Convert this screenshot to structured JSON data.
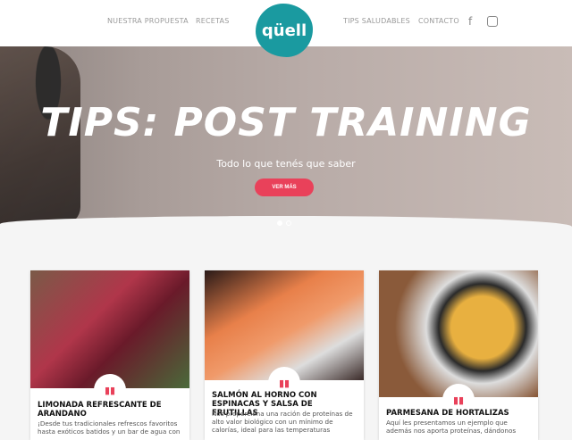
{
  "nav": {
    "items": [
      "NUESTRA PROPUESTA",
      "RECETAS",
      "TIPS SALUDABLES",
      "CONTACTO"
    ],
    "logo": "qüell",
    "social": [
      "facebook-icon",
      "instagram-icon"
    ]
  },
  "hero": {
    "title": "TIPS: POST TRAINING",
    "subtitle": "Todo lo que tenés que saber",
    "button": "VER MÁS",
    "slides": 2,
    "active_slide": 1
  },
  "cards": [
    {
      "title": "LIMONADA REFRESCANTE DE ARANDANO",
      "text": "¡Desde tus tradicionales refrescos favoritos hasta exóticos batidos y un bar de agua con",
      "icon": "book-icon"
    },
    {
      "title": "SALMÓN AL HORNO CON ESPINACAS Y SALSA DE FRUTILLAS",
      "text": "Nos proporciona una ración de proteínas de alto valor biológico con un mínimo de calorías, ideal para las temperaturas",
      "icon": "book-icon"
    },
    {
      "title": "PARMESANA DE HORTALIZAS",
      "text": "Aquí les presentamos un ejemplo que además nos aporta proteínas, dándonos",
      "icon": "book-icon"
    }
  ],
  "colors": {
    "brand": "#1a9aa0",
    "accent": "#e9415a"
  }
}
